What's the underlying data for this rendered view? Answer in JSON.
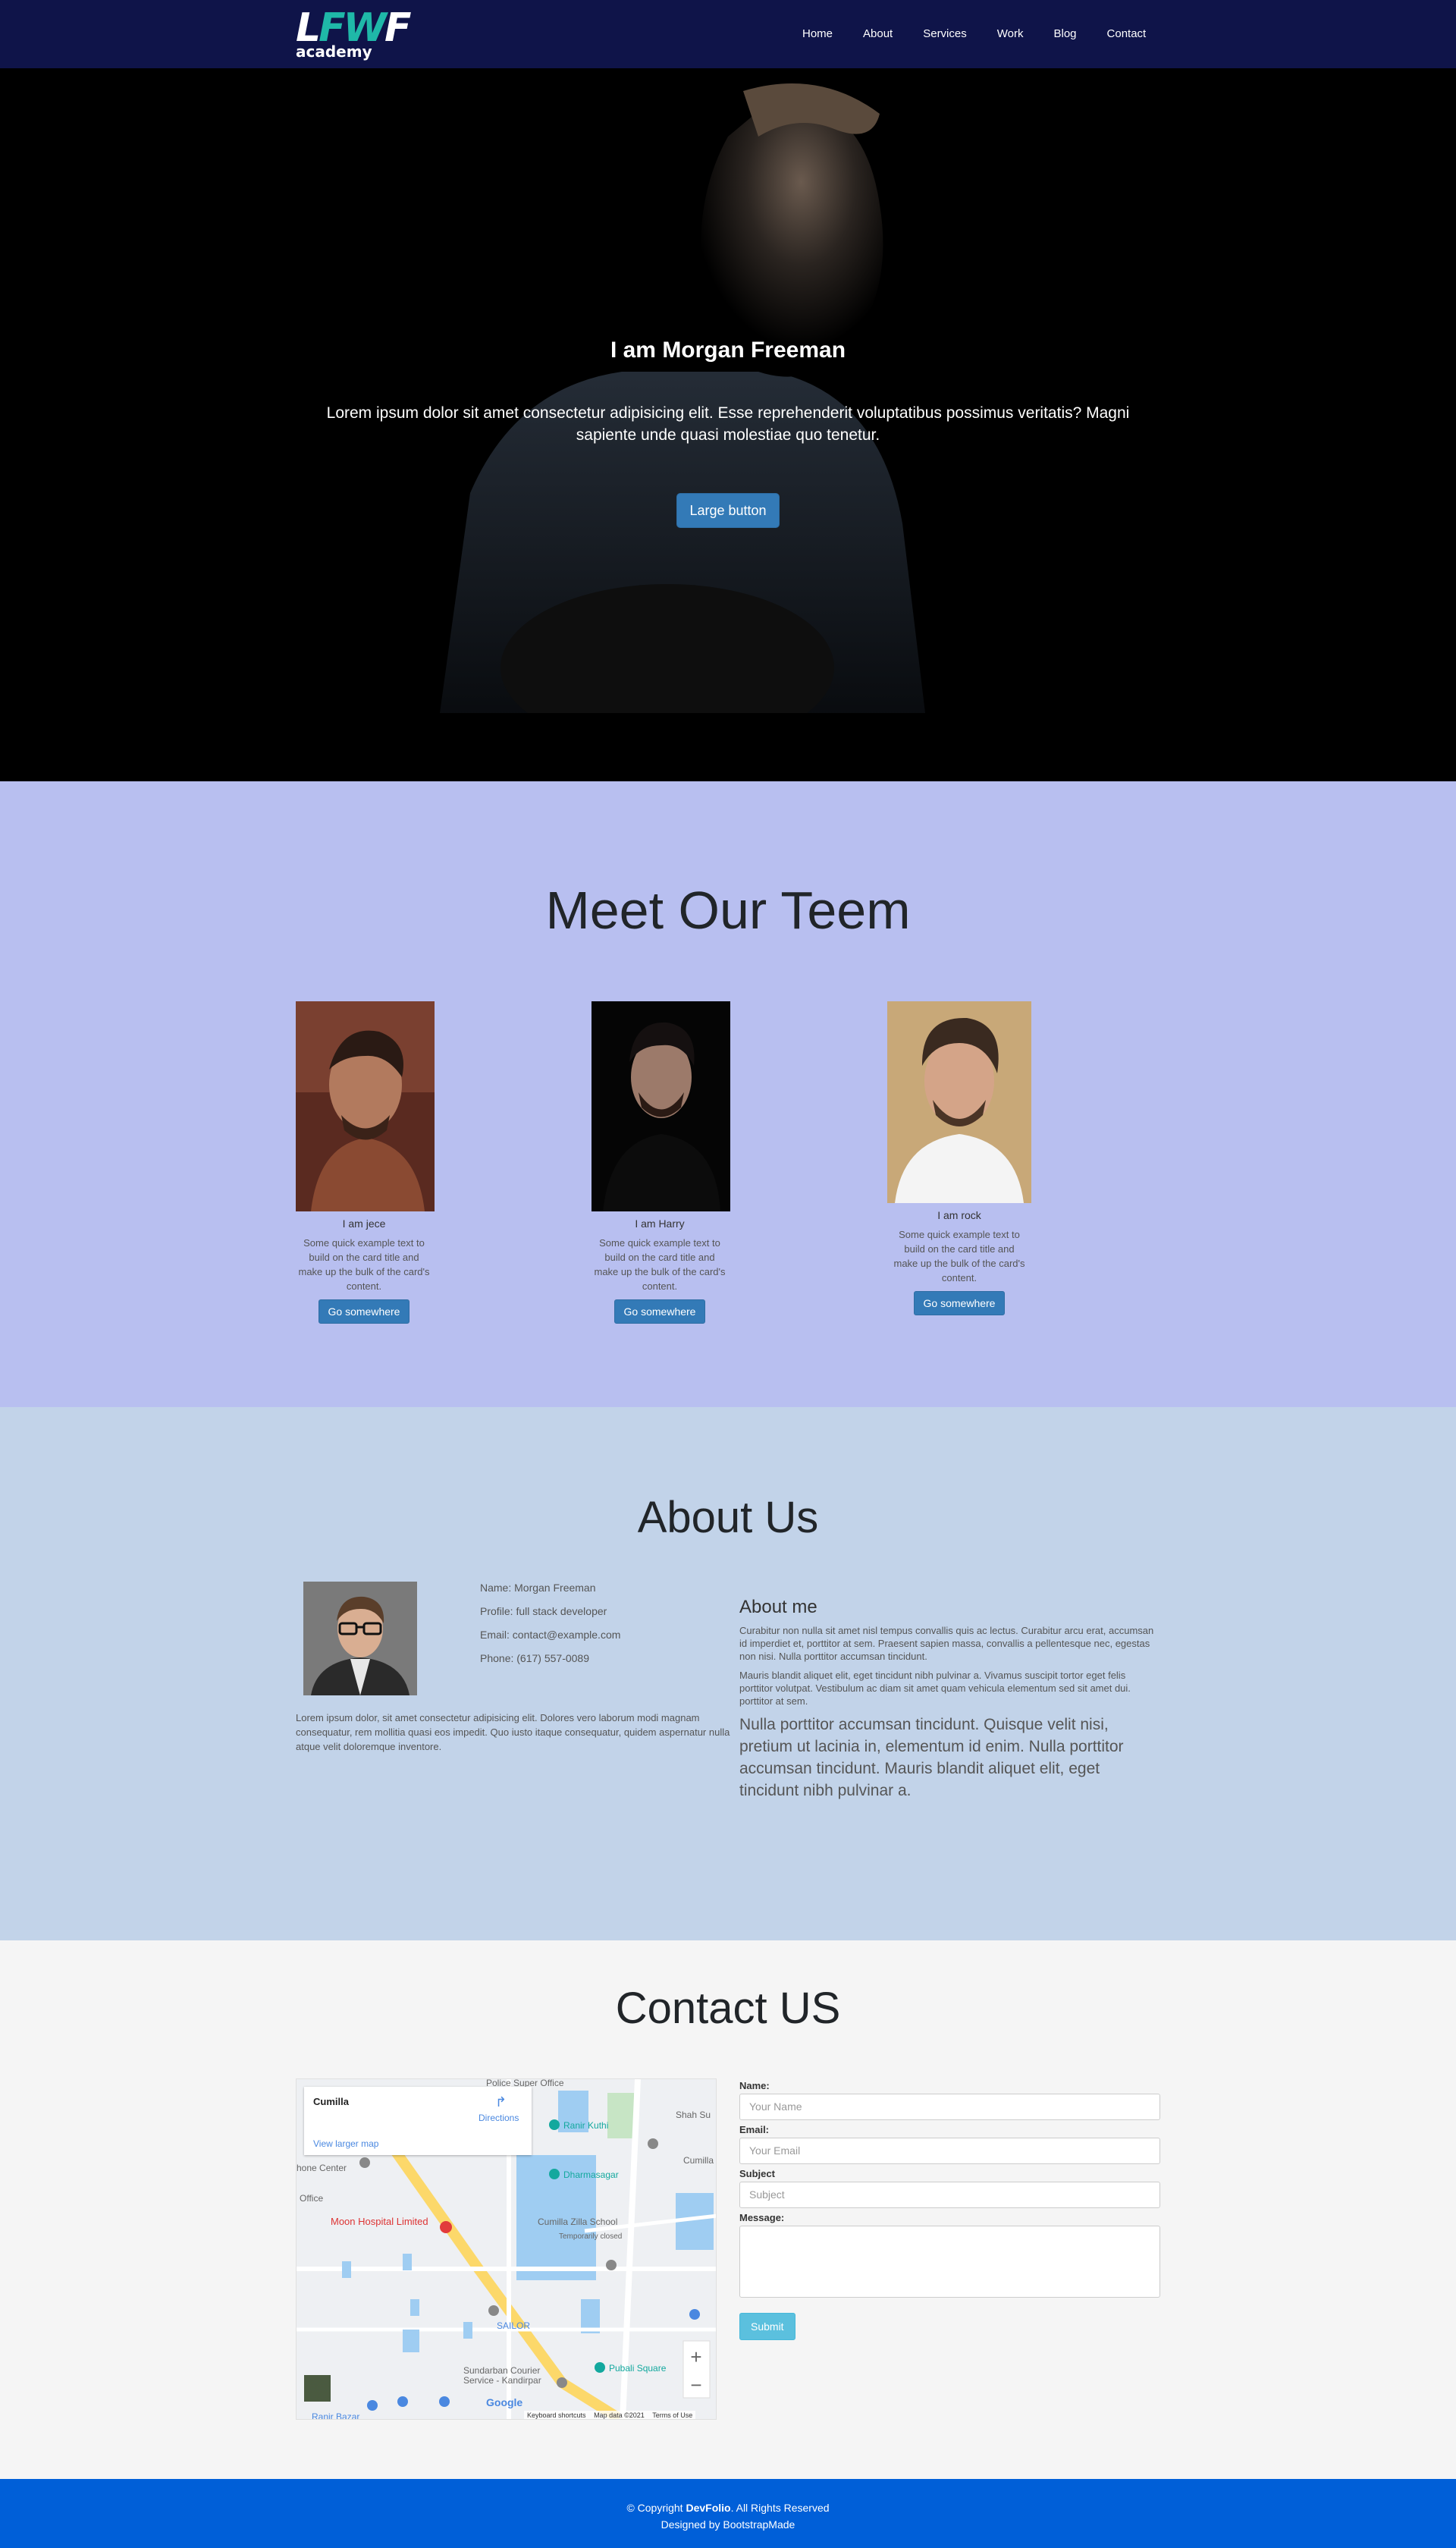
{
  "nav": {
    "logo_mark_a": "L",
    "logo_mark_b": "F",
    "logo_mark_c": "W",
    "logo_mark_d": "F",
    "logo_sub": "academy",
    "links": [
      "Home",
      "About",
      "Services",
      "Work",
      "Blog",
      "Contact"
    ]
  },
  "hero": {
    "title": "I am Morgan Freeman",
    "text": "Lorem ipsum dolor sit amet consectetur adipisicing elit. Esse reprehenderit voluptatibus possimus veritatis? Magni sapiente unde quasi molestiae quo tenetur.",
    "button": "Large button"
  },
  "team": {
    "title": "Meet Our Teem",
    "cards": [
      {
        "name": "I am jece",
        "text": "Some quick example text to build on the card title and make up the bulk of the card's content.",
        "button": "Go somewhere"
      },
      {
        "name": "I am Harry",
        "text": "Some quick example text to build on the card title and make up the bulk of the card's content.",
        "button": "Go somewhere"
      },
      {
        "name": "I am rock",
        "text": "Some quick example text to build on the card title and make up the bulk of the card's content.",
        "button": "Go somewhere"
      }
    ]
  },
  "about": {
    "title": "About Us",
    "name": "Name: Morgan Freeman",
    "profile": "Profile: full stack developer",
    "email": "Email: contact@example.com",
    "phone": "Phone: (617) 557-0089",
    "lorem": "Lorem ipsum dolor, sit amet consectetur adipisicing elit. Dolores vero laborum modi magnam consequatur, rem mollitia quasi eos impedit. Quo iusto itaque consequatur, quidem aspernatur nulla atque velit doloremque inventore.",
    "me_title": "About me",
    "p1": "Curabitur non nulla sit amet nisl tempus convallis quis ac lectus. Curabitur arcu erat, accumsan id imperdiet et, porttitor at sem. Praesent sapien massa, convallis a pellentesque nec, egestas non nisi. Nulla porttitor accumsan tincidunt.",
    "p2": "Mauris blandit aliquet elit, eget tincidunt nibh pulvinar a. Vivamus suscipit tortor eget felis porttitor volutpat. Vestibulum ac diam sit amet quam vehicula elementum sed sit amet dui. porttitor at sem.",
    "lead": "Nulla porttitor accumsan tincidunt. Quisque velit nisi, pretium ut lacinia in, elementum id enim. Nulla porttitor accumsan tincidunt. Mauris blandit aliquet elit, eget tincidunt nibh pulvinar a."
  },
  "contact": {
    "title": "Contact US",
    "map": {
      "place": "Cumilla",
      "directions": "Directions",
      "larger": "View larger map",
      "labels": [
        "Police Super Office",
        "Ranir Kuthi",
        "Shah Su",
        "Dharmasagar",
        "Cumilla",
        "Moon Hospital Limited",
        "Cumilla Zilla School",
        "Temporarily closed",
        "SAILOR",
        "Pubali Square",
        "Sundarban Courier Service - Kandirpar",
        "Ranir Bazar",
        "Office",
        "hone Center"
      ],
      "footer_keys": "Keyboard shortcuts",
      "footer_data": "Map data ©2021",
      "footer_terms": "Terms of Use",
      "google": "Google"
    },
    "form": {
      "name_label": "Name:",
      "name_placeholder": "Your Name",
      "email_label": "Email:",
      "email_placeholder": "Your Email",
      "subject_label": "Subject",
      "subject_placeholder": "Subject",
      "message_label": "Message:",
      "submit": "Submit"
    }
  },
  "footer": {
    "copy_a": "© Copyright ",
    "brand": "DevFolio",
    "copy_b": ". All Rights Reserved",
    "designed": "Designed by BootstrapMade"
  }
}
